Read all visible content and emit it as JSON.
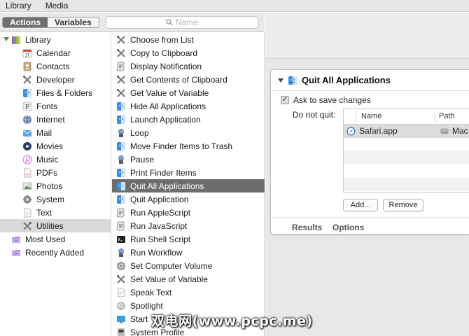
{
  "menubar": {
    "items": [
      "Library",
      "Media"
    ]
  },
  "toolbar": {
    "segments": [
      "Actions",
      "Variables"
    ],
    "active_segment": "Actions",
    "search_placeholder": "Name"
  },
  "library": {
    "root_label": "Library",
    "items": [
      {
        "label": "Calendar",
        "icon": "calendar-icon"
      },
      {
        "label": "Contacts",
        "icon": "contacts-icon"
      },
      {
        "label": "Developer",
        "icon": "developer-icon"
      },
      {
        "label": "Files & Folders",
        "icon": "finder-icon"
      },
      {
        "label": "Fonts",
        "icon": "fonts-icon"
      },
      {
        "label": "Internet",
        "icon": "globe-icon"
      },
      {
        "label": "Mail",
        "icon": "mail-icon"
      },
      {
        "label": "Movies",
        "icon": "movies-icon"
      },
      {
        "label": "Music",
        "icon": "music-icon"
      },
      {
        "label": "PDFs",
        "icon": "pdf-icon"
      },
      {
        "label": "Photos",
        "icon": "photos-icon"
      },
      {
        "label": "System",
        "icon": "system-icon"
      },
      {
        "label": "Text",
        "icon": "text-icon"
      },
      {
        "label": "Utilities",
        "icon": "utilities-icon"
      }
    ],
    "selected": "Utilities",
    "smart_groups": [
      {
        "label": "Most Used",
        "icon": "smart-folder-icon"
      },
      {
        "label": "Recently Added",
        "icon": "smart-folder-icon"
      }
    ]
  },
  "actions": {
    "items": [
      "Choose from List",
      "Copy to Clipboard",
      "Display Notification",
      "Get Contents of Clipboard",
      "Get Value of Variable",
      "Hide All Applications",
      "Launch Application",
      "Loop",
      "Move Finder Items to Trash",
      "Pause",
      "Print Finder Items",
      "Quit All Applications",
      "Quit Application",
      "Run AppleScript",
      "Run JavaScript",
      "Run Shell Script",
      "Run Workflow",
      "Set Computer Volume",
      "Set Value of Variable",
      "Speak Text",
      "Spotlight",
      "Start",
      "System Profile"
    ],
    "selected": "Quit All Applications"
  },
  "panel": {
    "title": "Quit All Applications",
    "ask_label": "Ask to save changes",
    "ask_checked": true,
    "do_not_quit_label": "Do not quit:",
    "columns": [
      "Name",
      "Path"
    ],
    "rows": [
      {
        "name": "Safari.app",
        "path": "Mac"
      }
    ],
    "add_label": "Add...",
    "remove_label": "Remove",
    "tabs": [
      "Results",
      "Options"
    ]
  },
  "watermark": "双电网(www.pcpc.me)",
  "colors": {
    "selection_dark": "#6d6d6d",
    "selection_light": "#d9d9d9",
    "safari_blue": "#1f7fe0"
  }
}
